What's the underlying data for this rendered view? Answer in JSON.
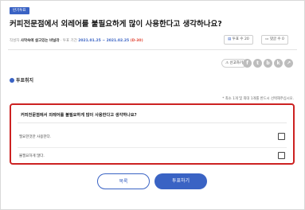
{
  "header": {
    "badge": "반기투표",
    "title": "커피전문점에서 외레어를 불필요하게 많이 사용한다고 생각하나요?",
    "author_label": "작성자",
    "author": "사막속에 살고있는 바닐라",
    "period_label": "· 투표 기간",
    "period": "2021.01.25 ~ 2021.02.25",
    "dday": "(D-30)"
  },
  "stats": {
    "vote_label": "투표 수",
    "vote_count": "20",
    "comment_label": "댓글 수",
    "comment_count": "0"
  },
  "actions": {
    "report_label": "신고하기",
    "sns": [
      "f",
      "t",
      "b",
      "k",
      "↗"
    ]
  },
  "cancel_vote_label": "투표취지",
  "vote_note": "* 최소 1개 및 최대 1개를 반드시 선택해주십시오.",
  "question": {
    "title": "커피전문점에서 외레어를 불필요하게 많이 사용한다고 생각하나요?",
    "options": [
      {
        "label": "필요한것만 사용한다."
      },
      {
        "label": "불필요하게 많다."
      }
    ]
  },
  "buttons": {
    "list_label": "목록",
    "vote_label": "투표하기"
  },
  "colors": {
    "accent": "#3a63c4",
    "highlight_border": "#cc2222",
    "dday": "#e24b3b"
  }
}
